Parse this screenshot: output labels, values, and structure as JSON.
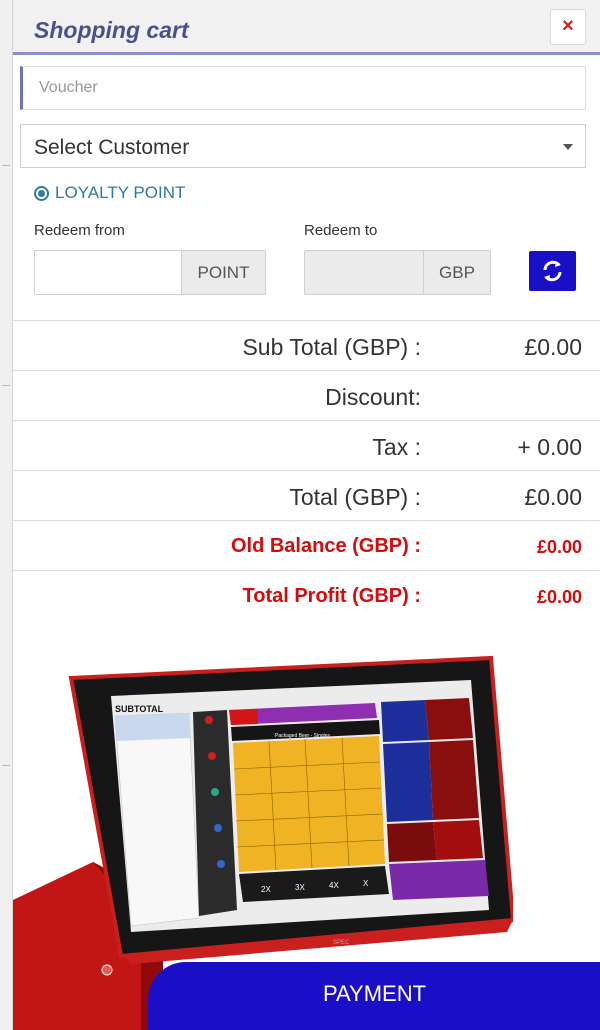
{
  "cart": {
    "title": "Shopping cart",
    "close_label": "×"
  },
  "voucher": {
    "placeholder": "Voucher",
    "value": ""
  },
  "customer_select": {
    "selected": "Select Customer"
  },
  "loyalty": {
    "label": "LOYALTY POINT",
    "redeem_from_label": "Redeem from",
    "redeem_to_label": "Redeem to",
    "from_unit": "POINT",
    "to_unit": "GBP",
    "from_value": "",
    "to_value": ""
  },
  "summary": {
    "subtotal_label": "Sub Total (GBP) :",
    "subtotal_value": "£0.00",
    "discount_label": "Discount:",
    "discount_value": "",
    "tax_label": "Tax :",
    "tax_value": "+ 0.00",
    "total_label": "Total (GBP) :",
    "total_value": "£0.00",
    "old_balance_label": "Old Balance (GBP) :",
    "old_balance_value": "£0.00",
    "total_profit_label": "Total Profit (GBP) :",
    "total_profit_value": "£0.00"
  },
  "pos_screen": {
    "header": "SUBTOTAL",
    "category_title": "Packaged Beer - Singles",
    "multiplier_buttons": [
      "2X",
      "3X",
      "4X",
      "X"
    ],
    "badge": "SPEC"
  },
  "payment": {
    "label": "PAYMENT"
  },
  "colors": {
    "accent": "#1a0fc6",
    "title": "#4a4f8e",
    "warning": "#d50c0c",
    "loyalty": "#2e7aa0",
    "close": "#d21f1f"
  },
  "icons": {
    "close": "close-icon",
    "refresh": "refresh-icon",
    "loyalty": "loyalty-icon",
    "dropdown": "chevron-down-icon"
  }
}
